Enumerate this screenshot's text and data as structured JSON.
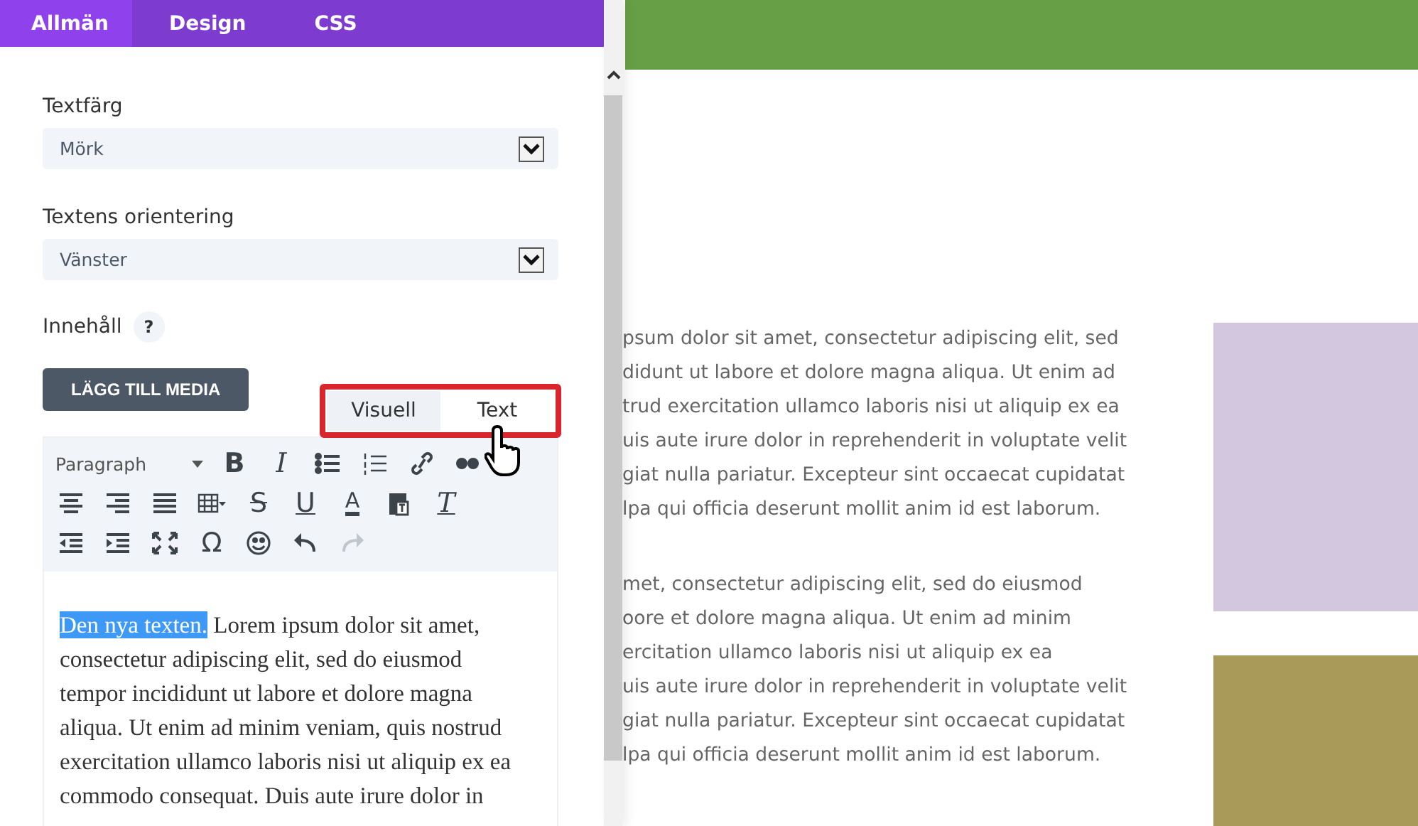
{
  "tabs": [
    {
      "label": "Allmän",
      "selected": true
    },
    {
      "label": "Design",
      "selected": false
    },
    {
      "label": "CSS",
      "selected": false
    }
  ],
  "fields": [
    {
      "label": "Textfärg",
      "value": "Mörk"
    },
    {
      "label": "Textens orientering",
      "value": "Vänster"
    }
  ],
  "content": {
    "label": "Innehåll",
    "help": "?",
    "media_button": "LÄGG TILL MEDIA",
    "editor_tabs": [
      {
        "label": "Visuell",
        "selected": false
      },
      {
        "label": "Text",
        "selected": true
      }
    ],
    "format": "Paragraph",
    "toolbar": [
      [
        {
          "kind": "bold",
          "glyph": "B",
          "disabled": false
        },
        {
          "kind": "italic",
          "glyph": "I",
          "disabled": false
        },
        {
          "kind": "bullets",
          "disabled": false
        },
        {
          "kind": "numbers",
          "disabled": false
        },
        {
          "kind": "link",
          "disabled": false
        },
        {
          "kind": "quote",
          "disabled": false
        }
      ],
      [
        {
          "kind": "center",
          "disabled": false
        },
        {
          "kind": "right",
          "disabled": false
        },
        {
          "kind": "justify",
          "disabled": false
        },
        {
          "kind": "table",
          "disabled": false
        },
        {
          "kind": "strike",
          "glyph": "S",
          "disabled": false
        },
        {
          "kind": "underline",
          "glyph": "U",
          "disabled": false
        },
        {
          "kind": "color",
          "glyph": "A",
          "disabled": false
        },
        {
          "kind": "paste",
          "disabled": false
        },
        {
          "kind": "clear",
          "glyph": "T",
          "disabled": false
        }
      ],
      [
        {
          "kind": "outdent",
          "disabled": false
        },
        {
          "kind": "indent",
          "disabled": false
        },
        {
          "kind": "fullscreen",
          "disabled": false
        },
        {
          "kind": "symbol",
          "glyph": "Ω",
          "disabled": false
        },
        {
          "kind": "emoji",
          "disabled": false
        },
        {
          "kind": "undo",
          "disabled": false
        },
        {
          "kind": "redo",
          "disabled": true
        }
      ]
    ],
    "selection": "Den nya texten.",
    "lines": [
      " Lorem ipsum dolor sit amet,",
      "consectetur adipiscing elit, sed do eiusmod",
      "tempor incididunt ut labore et dolore magna",
      "aliqua. Ut enim ad minim veniam, quis nostrud",
      "exercitation ullamco laboris nisi ut aliquip ex ea",
      "commodo consequat. Duis aute irure dolor in"
    ]
  },
  "preview": {
    "paragraphs": [
      [
        "psum dolor sit amet, consectetur adipiscing elit, sed",
        "didunt ut labore et dolore magna aliqua. Ut enim ad",
        "trud exercitation ullamco laboris nisi ut aliquip ex ea",
        "uis aute irure dolor in reprehenderit in voluptate velit",
        "giat nulla pariatur. Excepteur sint occaecat cupidatat",
        "lpa qui officia deserunt mollit anim id est laborum."
      ],
      [
        "met, consectetur adipiscing elit, sed do eiusmod",
        "oore et dolore magna aliqua. Ut enim ad minim",
        "ercitation ullamco laboris nisi ut aliquip ex ea",
        "uis aute irure dolor in reprehenderit in voluptate velit",
        "giat nulla pariatur. Excepteur sint occaecat cupidatat",
        "lpa qui officia deserunt mollit anim id est laborum."
      ]
    ],
    "blocks": [
      {
        "color": "#679f46"
      },
      {
        "color": "#d3c6df"
      },
      {
        "color": "#aa9a5a"
      }
    ]
  }
}
